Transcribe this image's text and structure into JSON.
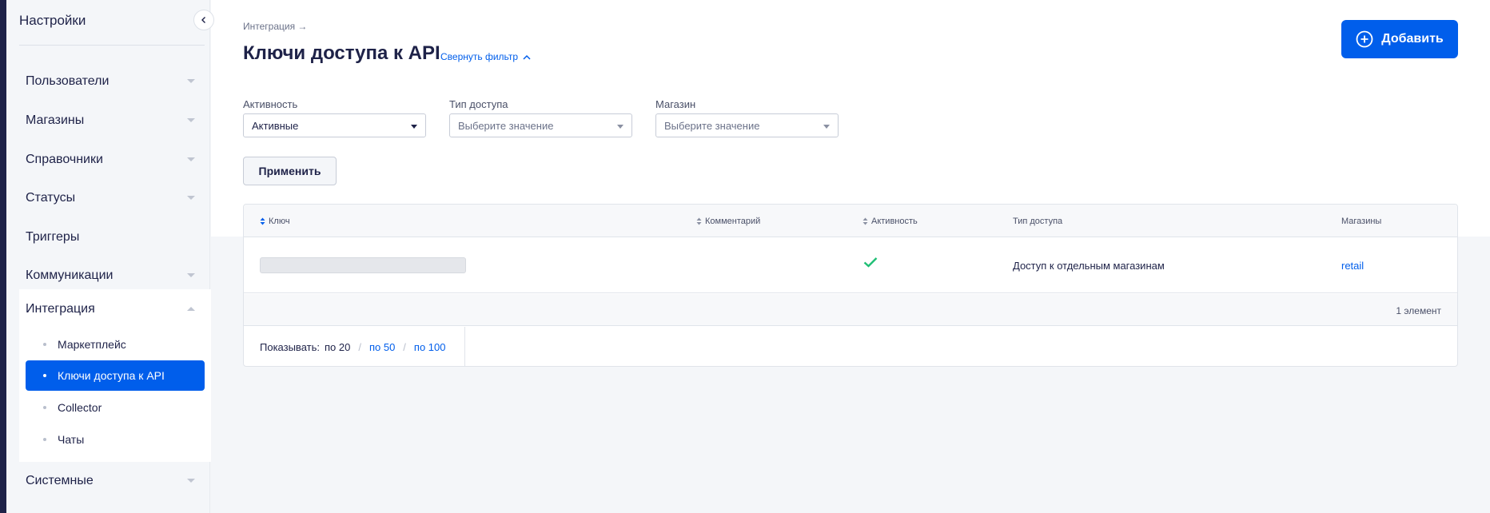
{
  "sidebar": {
    "title": "Настройки",
    "items": [
      {
        "label": "Пользователи"
      },
      {
        "label": "Магазины"
      },
      {
        "label": "Справочники"
      },
      {
        "label": "Статусы"
      },
      {
        "label": "Триггеры"
      },
      {
        "label": "Коммуникации"
      },
      {
        "label": "Интеграция"
      },
      {
        "label": "Системные"
      }
    ],
    "integration_subitems": [
      {
        "label": "Маркетплейс"
      },
      {
        "label": "Ключи доступа к API"
      },
      {
        "label": "Collector"
      },
      {
        "label": "Чаты"
      }
    ]
  },
  "header": {
    "breadcrumb": "Интеграция →",
    "title": "Ключи доступа к API",
    "collapse_filter": "Свернуть фильтр",
    "add_button": "Добавить"
  },
  "filters": {
    "activity": {
      "label": "Активность",
      "value": "Активные"
    },
    "access_type": {
      "label": "Тип доступа",
      "placeholder": "Выберите значение"
    },
    "store": {
      "label": "Магазин",
      "placeholder": "Выберите значение"
    },
    "apply_button": "Применить"
  },
  "table": {
    "columns": [
      "Ключ",
      "Комментарий",
      "Активность",
      "Тип доступа",
      "Магазины"
    ],
    "rows": [
      {
        "key": "",
        "comment": "",
        "active": true,
        "access_type": "Доступ к отдельным магазинам",
        "stores": "retail"
      }
    ],
    "count": "1 элемент",
    "pager": {
      "label": "Показывать:",
      "options": [
        "по 20",
        "по 50",
        "по 100"
      ]
    }
  },
  "colors": {
    "accent": "#005eeb",
    "check": "#1fbf75",
    "text": "#1e2248"
  }
}
